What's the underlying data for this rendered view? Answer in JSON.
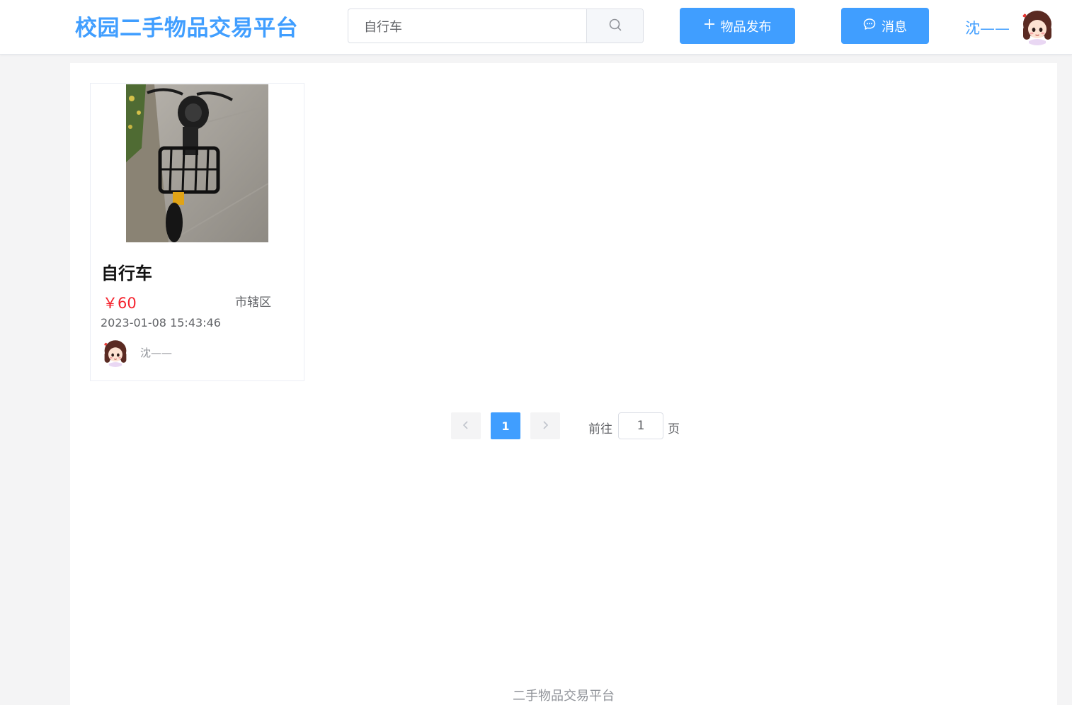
{
  "header": {
    "logo": "校园二手物品交易平台",
    "search": {
      "value": "自行车",
      "placeholder": ""
    },
    "publish_label": "物品发布",
    "message_label": "消息",
    "user_name": "沈——"
  },
  "icons": {
    "search": "search-icon",
    "plus": "plus-icon",
    "chat": "chat-bubble-icon",
    "prev": "chevron-left-icon",
    "next": "chevron-right-icon"
  },
  "colors": {
    "primary": "#409eff",
    "price": "#f5222d"
  },
  "items": [
    {
      "title": "自行车",
      "price": "￥60",
      "region": "市辖区",
      "time": "2023-01-08 15:43:46",
      "seller": "沈——"
    }
  ],
  "pagination": {
    "current_page": "1",
    "goto_prefix": "前往",
    "goto_value": "1",
    "goto_suffix": "页"
  },
  "footer": {
    "text": "二手物品交易平台"
  }
}
